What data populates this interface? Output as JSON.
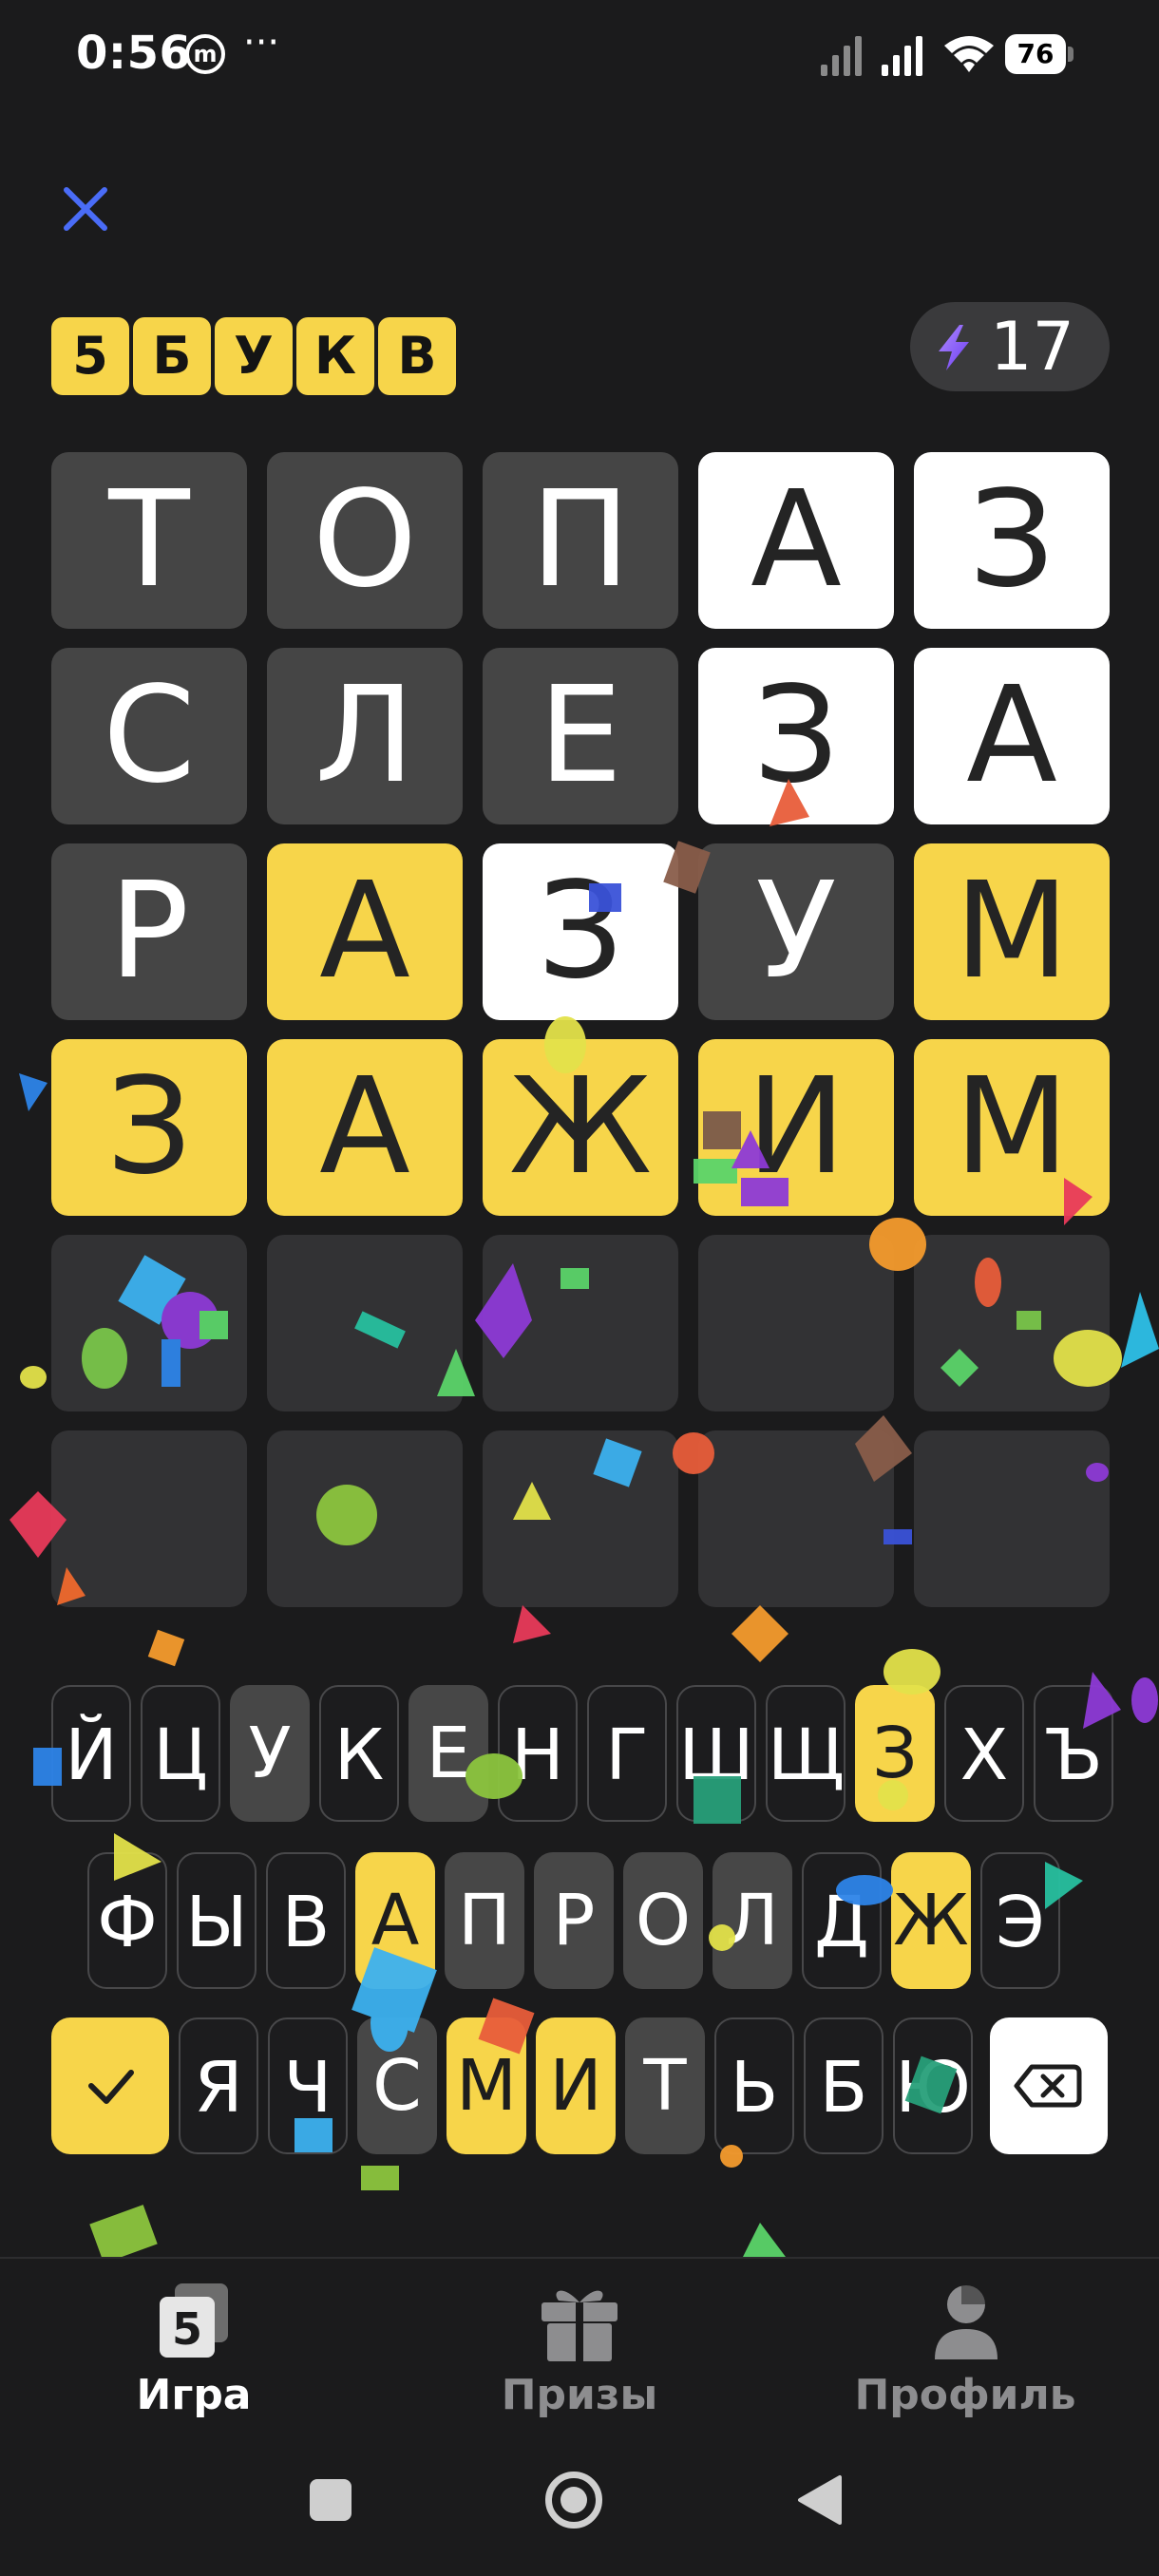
{
  "status_bar": {
    "time": "0:56",
    "extra": "···",
    "battery": "76"
  },
  "header": {
    "title_letters": [
      "5",
      "Б",
      "У",
      "К",
      "В"
    ],
    "energy_count": "17"
  },
  "board": [
    [
      {
        "l": "Т",
        "s": "gray"
      },
      {
        "l": "О",
        "s": "gray"
      },
      {
        "l": "П",
        "s": "gray"
      },
      {
        "l": "А",
        "s": "white"
      },
      {
        "l": "З",
        "s": "white"
      }
    ],
    [
      {
        "l": "С",
        "s": "gray"
      },
      {
        "l": "Л",
        "s": "gray"
      },
      {
        "l": "Е",
        "s": "gray"
      },
      {
        "l": "З",
        "s": "white"
      },
      {
        "l": "А",
        "s": "white"
      }
    ],
    [
      {
        "l": "Р",
        "s": "gray"
      },
      {
        "l": "А",
        "s": "yellow"
      },
      {
        "l": "З",
        "s": "white"
      },
      {
        "l": "У",
        "s": "gray"
      },
      {
        "l": "М",
        "s": "yellow"
      }
    ],
    [
      {
        "l": "З",
        "s": "yellow"
      },
      {
        "l": "А",
        "s": "yellow"
      },
      {
        "l": "Ж",
        "s": "yellow"
      },
      {
        "l": "И",
        "s": "yellow"
      },
      {
        "l": "М",
        "s": "yellow"
      }
    ],
    [
      {
        "l": "",
        "s": "empty"
      },
      {
        "l": "",
        "s": "empty"
      },
      {
        "l": "",
        "s": "empty"
      },
      {
        "l": "",
        "s": "empty"
      },
      {
        "l": "",
        "s": "empty"
      }
    ],
    [
      {
        "l": "",
        "s": "empty"
      },
      {
        "l": "",
        "s": "empty"
      },
      {
        "l": "",
        "s": "empty"
      },
      {
        "l": "",
        "s": "empty"
      },
      {
        "l": "",
        "s": "empty"
      }
    ]
  ],
  "keyboard": {
    "row1": [
      {
        "l": "Й",
        "s": "default"
      },
      {
        "l": "Ц",
        "s": "default"
      },
      {
        "l": "У",
        "s": "gray"
      },
      {
        "l": "К",
        "s": "default"
      },
      {
        "l": "Е",
        "s": "gray"
      },
      {
        "l": "Н",
        "s": "default"
      },
      {
        "l": "Г",
        "s": "default"
      },
      {
        "l": "Ш",
        "s": "default"
      },
      {
        "l": "Щ",
        "s": "default"
      },
      {
        "l": "З",
        "s": "yellow"
      },
      {
        "l": "Х",
        "s": "default"
      },
      {
        "l": "Ъ",
        "s": "default"
      }
    ],
    "row2": [
      {
        "l": "Ф",
        "s": "default"
      },
      {
        "l": "Ы",
        "s": "default"
      },
      {
        "l": "В",
        "s": "default"
      },
      {
        "l": "А",
        "s": "yellow"
      },
      {
        "l": "П",
        "s": "gray"
      },
      {
        "l": "Р",
        "s": "gray"
      },
      {
        "l": "О",
        "s": "gray"
      },
      {
        "l": "Л",
        "s": "gray"
      },
      {
        "l": "Д",
        "s": "default"
      },
      {
        "l": "Ж",
        "s": "yellow"
      },
      {
        "l": "Э",
        "s": "default"
      }
    ],
    "row3": [
      {
        "l": "Я",
        "s": "default"
      },
      {
        "l": "Ч",
        "s": "default"
      },
      {
        "l": "С",
        "s": "gray"
      },
      {
        "l": "М",
        "s": "yellow"
      },
      {
        "l": "И",
        "s": "yellow"
      },
      {
        "l": "Т",
        "s": "gray"
      },
      {
        "l": "Ь",
        "s": "default"
      },
      {
        "l": "Б",
        "s": "default"
      },
      {
        "l": "Ю",
        "s": "default"
      }
    ],
    "enter_icon": "checkmark-icon",
    "backspace_icon": "backspace-icon"
  },
  "bottom_nav": {
    "items": [
      {
        "label": "Игра",
        "icon": "game-icon",
        "active": true
      },
      {
        "label": "Призы",
        "icon": "gift-icon",
        "active": false
      },
      {
        "label": "Профиль",
        "icon": "profile-icon",
        "active": false
      }
    ]
  },
  "colors": {
    "background": "#1b1b1c",
    "yellow": "#f7d54a",
    "gray_tile": "#454545",
    "white_tile": "#ffffff",
    "empty_tile": "#323234",
    "close_icon": "#4a6cf7"
  }
}
